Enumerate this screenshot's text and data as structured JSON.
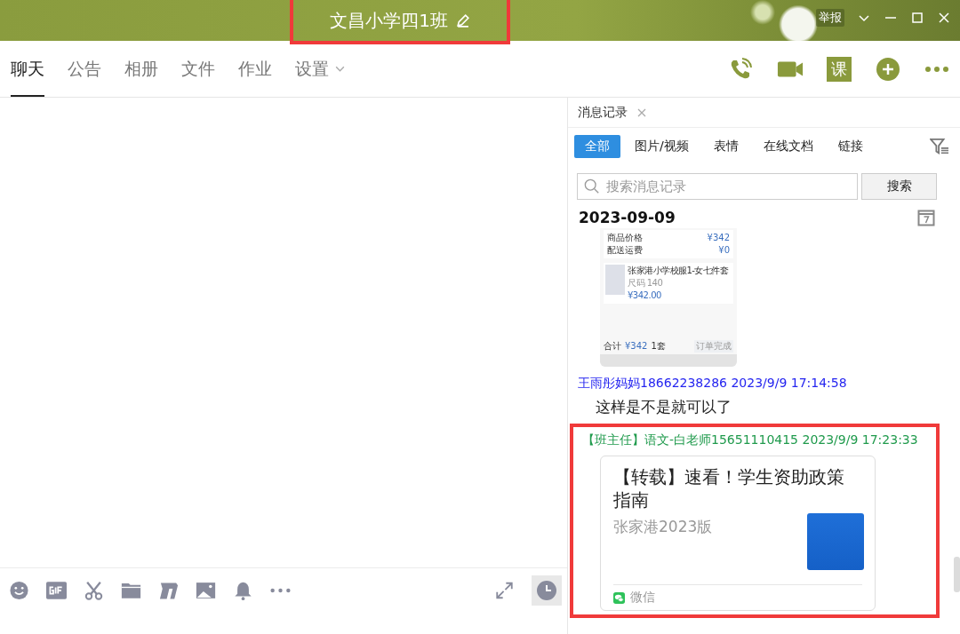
{
  "window": {
    "title": "文昌小学四1班",
    "report_label": "举报"
  },
  "tabs": [
    {
      "label": "聊天",
      "selected": true,
      "dropdown": false
    },
    {
      "label": "公告",
      "selected": false,
      "dropdown": false
    },
    {
      "label": "相册",
      "selected": false,
      "dropdown": false
    },
    {
      "label": "文件",
      "selected": false,
      "dropdown": false
    },
    {
      "label": "作业",
      "selected": false,
      "dropdown": false
    },
    {
      "label": "设置",
      "selected": false,
      "dropdown": true
    }
  ],
  "toolbar": {
    "lesson_label": "课"
  },
  "history_panel": {
    "tab_label": "消息记录",
    "filters": [
      {
        "label": "全部",
        "selected": true
      },
      {
        "label": "图片/视频",
        "selected": false
      },
      {
        "label": "表情",
        "selected": false
      },
      {
        "label": "在线文档",
        "selected": false
      },
      {
        "label": "链接",
        "selected": false
      }
    ],
    "search": {
      "placeholder": "搜索消息记录",
      "button": "搜索"
    },
    "date": "2023-09-09",
    "messages": [
      {
        "kind": "image",
        "shot": {
          "rows": [
            {
              "label": "商品价格",
              "value": "¥342"
            },
            {
              "label": "配送运费",
              "value": "¥0"
            }
          ],
          "product": {
            "name": "张家港小学校服1-女七件套",
            "size": "尺码 140",
            "price": "¥342.00"
          },
          "total_label": "合计",
          "total": "¥342",
          "count": "1套",
          "status": "订单完成"
        }
      },
      {
        "kind": "sender",
        "text": "王雨彤妈妈18662238286 2023/9/9 17:14:58",
        "color": "#2424f0",
        "highlight": false
      },
      {
        "kind": "text",
        "text": "这样是不是就可以了"
      },
      {
        "kind": "sender",
        "text": "【班主任】语文-白老师15651110415 2023/9/9 17:23:33",
        "color": "#1f9a4c",
        "highlight": true,
        "card": {
          "title": "【转载】速看！学生资助政策指南",
          "subtitle": "张家港2023版",
          "source": "微信"
        }
      }
    ]
  }
}
